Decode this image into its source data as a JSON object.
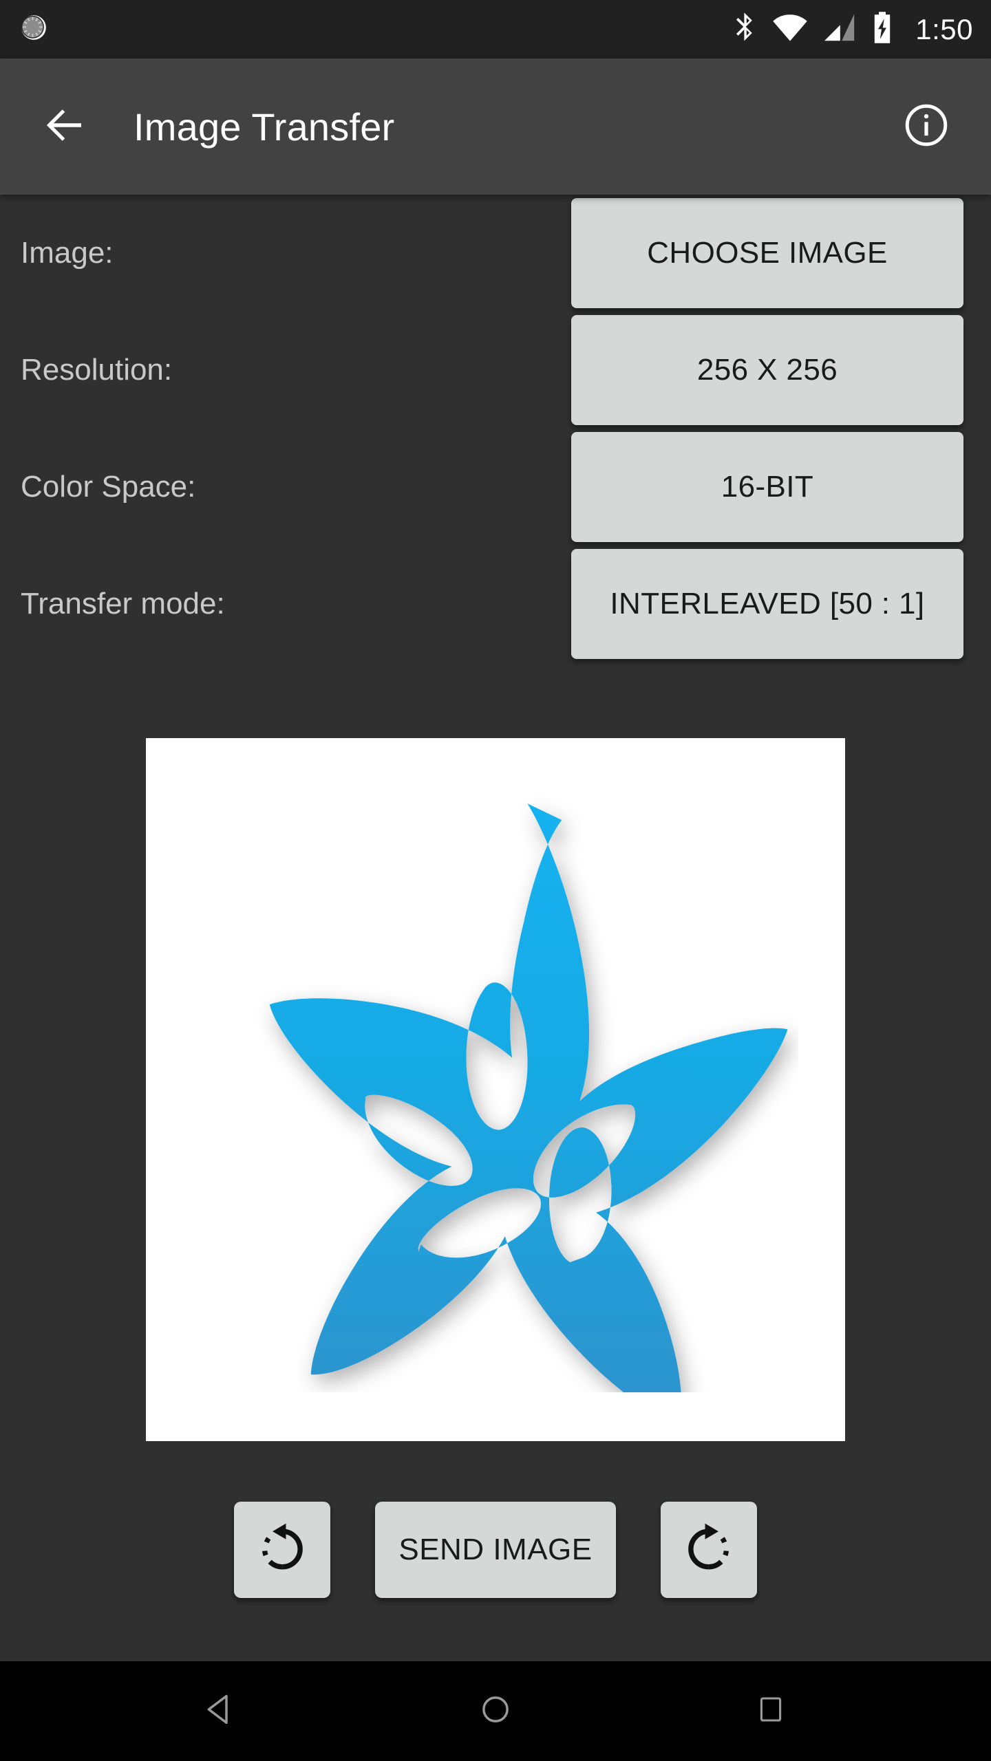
{
  "status_bar": {
    "notification_icon": "brightness-icon",
    "icons": [
      "bluetooth-icon",
      "wifi-icon",
      "cellular-signal-icon",
      "battery-charging-icon"
    ],
    "time": "1:50",
    "background_color": "#212121"
  },
  "app_bar": {
    "back_icon": "arrow-back-icon",
    "title": "Image Transfer",
    "info_icon": "info-icon",
    "background_color": "#424242"
  },
  "settings": [
    {
      "label": "Image:",
      "value": "CHOOSE IMAGE"
    },
    {
      "label": "Resolution:",
      "value": "256 X 256"
    },
    {
      "label": "Color Space:",
      "value": "16-BIT"
    },
    {
      "label": "Transfer mode:",
      "value": "INTERLEAVED [50 : 1]"
    }
  ],
  "preview": {
    "alt": "adafruit-flower-logo",
    "background_color": "#ffffff",
    "logo_color_light": "#18b0ec",
    "logo_color_dark": "#2b93ce"
  },
  "actions": {
    "rotate_left_icon": "rotate-left-icon",
    "send_label": "SEND IMAGE",
    "rotate_right_icon": "rotate-right-icon"
  },
  "nav_bar": {
    "back_icon": "nav-back-triangle-icon",
    "home_icon": "nav-home-circle-icon",
    "recents_icon": "nav-recents-square-icon",
    "background_color": "#000000"
  },
  "theme": {
    "content_background": "#303030",
    "button_background": "#d6d8d8",
    "label_color": "#c9c9c9"
  }
}
